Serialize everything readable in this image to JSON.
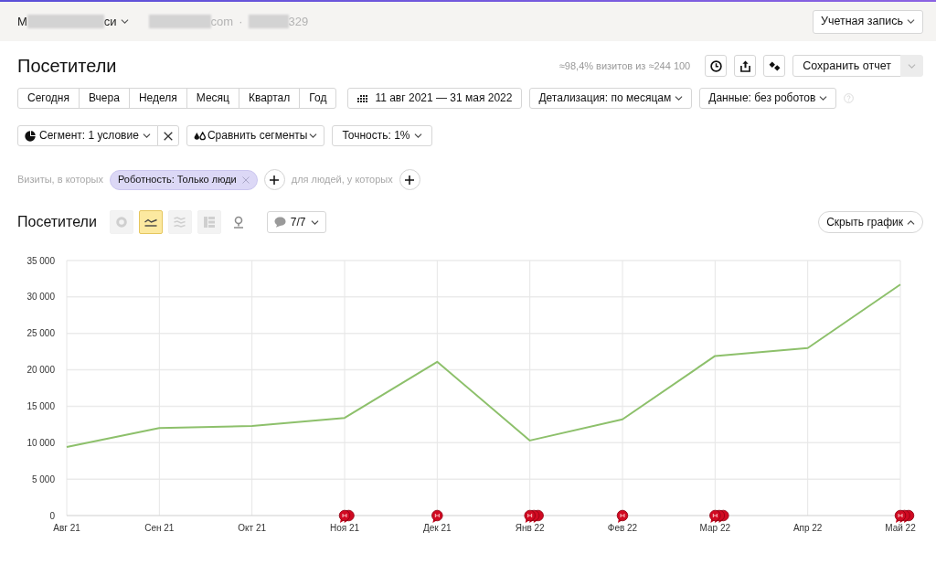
{
  "header": {
    "account": {
      "text_start": "M",
      "text_end": "си"
    },
    "site": {
      "domain_end": "com",
      "separator": "·",
      "counter_end": "329"
    },
    "account_button": "Учетная запись"
  },
  "report": {
    "title": "Посетители",
    "sampling_note": "≈98,4% визитов из ≈244 100",
    "save_button": "Сохранить отчет"
  },
  "periods": [
    {
      "label": "Сегодня",
      "selected": false
    },
    {
      "label": "Вчера",
      "selected": false
    },
    {
      "label": "Неделя",
      "selected": false
    },
    {
      "label": "Месяц",
      "selected": false
    },
    {
      "label": "Квартал",
      "selected": false
    },
    {
      "label": "Год",
      "selected": false
    }
  ],
  "date_range": "11 авг 2021 — 31 мая 2022",
  "dropdowns": [
    "Детализация: по месяцам",
    "Данные: без роботов"
  ],
  "segment_button": "Сегмент: 1 условие",
  "compare_button": "Сравнить сегменты",
  "accuracy_button": "Точность: 1%",
  "conditions": {
    "visits_label": "Визиты, в которых",
    "chips": [
      {
        "label": "Роботность: Только люди"
      }
    ],
    "people_label": "для людей, у которых"
  },
  "chart_section": {
    "title": "Посетители",
    "chart_types": [
      {
        "kind": "pie",
        "selected": false
      },
      {
        "kind": "line",
        "selected": true
      },
      {
        "kind": "area",
        "selected": false
      },
      {
        "kind": "table",
        "selected": false
      },
      {
        "kind": "map",
        "selected": false
      }
    ],
    "notes_filter": "7/7",
    "hide_button": "Скрыть график",
    "chart_data": {
      "type": "line",
      "grid": true,
      "categories": [
        "Авг 21",
        "Сен 21",
        "Окт 21",
        "Ноя 21",
        "Дек 21",
        "Янв 22",
        "Фев 22",
        "Мар 22",
        "Апр 22",
        "Май 22"
      ],
      "values": [
        9400,
        12000,
        12300,
        13400,
        21100,
        10300,
        13200,
        21900,
        23000,
        31700
      ],
      "ylim": [
        0,
        35000
      ],
      "yticks": [
        0,
        {
          "value": 5000,
          "label": "5 000"
        },
        {
          "value": 10000,
          "label": "10 000"
        },
        {
          "value": 15000,
          "label": "15 000"
        },
        {
          "value": 20000,
          "label": "20 000"
        },
        {
          "value": 25000,
          "label": "25 000"
        },
        {
          "value": 30000,
          "label": "30 000"
        },
        {
          "value": 35000,
          "label": "35 000"
        }
      ],
      "annotations": [
        {
          "x": "Ноя 21"
        },
        {
          "x": "Ноя 21"
        },
        {
          "x": "Дек 21"
        },
        {
          "x": "Янв 22"
        },
        {
          "x": "Янв 22"
        },
        {
          "x": "Янв 22"
        },
        {
          "x": "Фев 22"
        },
        {
          "x": "Мар 22"
        },
        {
          "x": "Мар 22"
        },
        {
          "x": "Мар 22"
        },
        {
          "x": "Май 22"
        },
        {
          "x": "Май 22"
        },
        {
          "x": "Май 22"
        }
      ]
    }
  }
}
